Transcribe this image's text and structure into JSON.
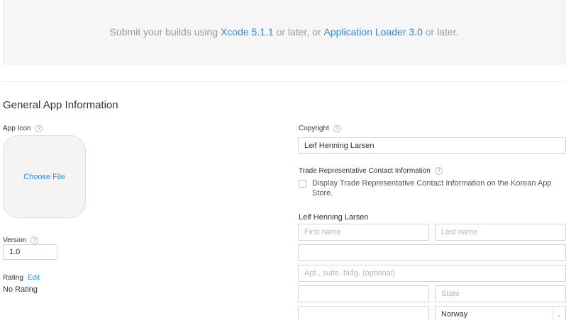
{
  "banner": {
    "prefix": "Submit your builds using ",
    "xcode_link": "Xcode 5.1.1",
    "middle": " or later, or ",
    "loader_link": "Application Loader 3.0",
    "suffix": " or later."
  },
  "section_title": "General App Information",
  "app_icon": {
    "label": "App Icon",
    "button": "Choose File"
  },
  "version": {
    "label": "Version",
    "value": "1.0"
  },
  "rating": {
    "label": "Rating",
    "edit": "Edit",
    "value": "No Rating"
  },
  "copyright": {
    "label": "Copyright",
    "value": "Leif Henning Larsen"
  },
  "trade_rep": {
    "label": "Trade Representative Contact Information",
    "checkbox_label": "Display Trade Representative Contact Information on the Korean App Store.",
    "name": "Leif Henning Larsen",
    "first_name_placeholder": "First name",
    "last_name_placeholder": "Last name",
    "address_value": "",
    "apt_placeholder": "Apt., suite, bldg. (optional)",
    "city_value": "",
    "state_placeholder": "State",
    "postal_value": "",
    "country_value": "Norway"
  },
  "help_glyph": "?",
  "colors": {
    "link": "#2d8ae0",
    "banner_bg": "#f6f6f6"
  }
}
